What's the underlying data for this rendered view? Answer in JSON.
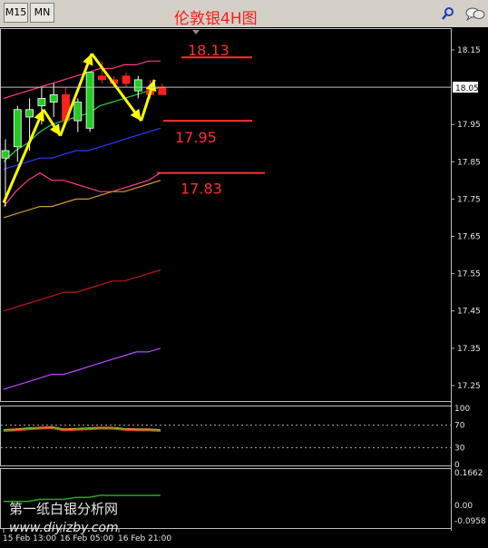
{
  "toolbar": {
    "tabs": [
      {
        "label": "M15"
      },
      {
        "label": "MN"
      }
    ],
    "title": "伦敦银4H图",
    "search_icon": "search-icon",
    "chat_icon": "chat-icon"
  },
  "chart_data": {
    "type": "candlestick",
    "title": "伦敦银4H图",
    "price_axis": {
      "ticks": [
        18.15,
        17.95,
        17.85,
        17.75,
        17.65,
        17.55,
        17.45,
        17.35,
        17.25
      ],
      "current_price_label": "18.05",
      "current_price": 18.05
    },
    "time_axis": {
      "labels": [
        "15 Feb 13:00",
        "16 Feb 05:00",
        "16 Feb 21:00"
      ]
    },
    "candles": [
      {
        "o": 17.86,
        "h": 17.91,
        "l": 17.73,
        "c": 17.88
      },
      {
        "o": 17.89,
        "h": 18.0,
        "l": 17.85,
        "c": 17.99
      },
      {
        "o": 17.97,
        "h": 18.02,
        "l": 17.88,
        "c": 17.99
      },
      {
        "o": 18.0,
        "h": 18.05,
        "l": 17.95,
        "c": 18.02
      },
      {
        "o": 18.01,
        "h": 18.06,
        "l": 17.97,
        "c": 18.03
      },
      {
        "o": 18.03,
        "h": 18.05,
        "l": 17.95,
        "c": 17.96
      },
      {
        "o": 17.96,
        "h": 18.02,
        "l": 17.93,
        "c": 18.01
      },
      {
        "o": 17.94,
        "h": 18.09,
        "l": 17.93,
        "c": 18.09
      },
      {
        "o": 18.08,
        "h": 18.12,
        "l": 18.06,
        "c": 18.07
      },
      {
        "o": 18.07,
        "h": 18.08,
        "l": 18.05,
        "c": 18.06
      },
      {
        "o": 18.08,
        "h": 18.09,
        "l": 18.05,
        "c": 18.06
      },
      {
        "o": 18.04,
        "h": 18.08,
        "l": 18.02,
        "c": 18.07
      },
      {
        "o": 18.05,
        "h": 18.07,
        "l": 18.02,
        "c": 18.03
      },
      {
        "o": 18.05,
        "h": 18.06,
        "l": 18.03,
        "c": 18.03
      }
    ],
    "levels": [
      {
        "label": "18.13",
        "value": 18.13,
        "color": "#ff3030"
      },
      {
        "label": "17.95",
        "value": 17.96,
        "color": "#ff3030"
      },
      {
        "label": "17.83",
        "value": 17.82,
        "color": "#ff3030"
      }
    ],
    "indicators": [
      {
        "name": "upper",
        "color": "#ff3b8a",
        "values": [
          18.02,
          18.03,
          18.04,
          18.05,
          18.06,
          18.07,
          18.08,
          18.09,
          18.1,
          18.1,
          18.11,
          18.11,
          18.12,
          18.12
        ]
      },
      {
        "name": "ma-green",
        "color": "#33cc33",
        "values": [
          17.85,
          17.88,
          17.9,
          17.93,
          17.95,
          17.96,
          17.97,
          17.98,
          18.0,
          18.01,
          18.02,
          18.03,
          18.04,
          18.05
        ]
      },
      {
        "name": "mid-blue",
        "color": "#2a3cff",
        "values": [
          17.83,
          17.84,
          17.85,
          17.86,
          17.86,
          17.87,
          17.88,
          17.88,
          17.89,
          17.9,
          17.91,
          17.92,
          17.93,
          17.94
        ]
      },
      {
        "name": "lower",
        "color": "#ff3b8a",
        "values": [
          17.73,
          17.77,
          17.8,
          17.82,
          17.8,
          17.8,
          17.79,
          17.78,
          17.77,
          17.77,
          17.78,
          17.79,
          17.8,
          17.82
        ]
      },
      {
        "name": "ma-orange",
        "color": "#d69a2a",
        "values": [
          17.7,
          17.71,
          17.72,
          17.73,
          17.73,
          17.74,
          17.75,
          17.75,
          17.76,
          17.77,
          17.77,
          17.78,
          17.79,
          17.8
        ]
      },
      {
        "name": "ma-red",
        "color": "#c01818",
        "values": [
          17.45,
          17.46,
          17.47,
          17.48,
          17.49,
          17.5,
          17.5,
          17.51,
          17.52,
          17.53,
          17.53,
          17.54,
          17.55,
          17.56
        ]
      },
      {
        "name": "ma-violet",
        "color": "#b44cff",
        "values": [
          17.24,
          17.25,
          17.26,
          17.27,
          17.28,
          17.28,
          17.29,
          17.3,
          17.31,
          17.32,
          17.33,
          17.34,
          17.34,
          17.35
        ]
      }
    ],
    "arrows": [
      {
        "from": [
          0,
          17.74
        ],
        "to": [
          3.3,
          17.99
        ]
      },
      {
        "from": [
          3.3,
          17.99
        ],
        "to": [
          4.7,
          17.92
        ]
      },
      {
        "from": [
          4.7,
          17.92
        ],
        "to": [
          7.3,
          18.14
        ]
      },
      {
        "from": [
          7.3,
          18.14
        ],
        "to": [
          11.4,
          17.96
        ]
      },
      {
        "from": [
          11.4,
          17.96
        ],
        "to": [
          12.5,
          18.07
        ]
      }
    ],
    "rsi": {
      "ticks": [
        "100",
        "70",
        "30",
        "0"
      ],
      "levels": [
        70,
        30
      ],
      "values": [
        62,
        63,
        65,
        66,
        67,
        63,
        64,
        65,
        66,
        66,
        64,
        63,
        63,
        62
      ],
      "color": "#ff3030"
    },
    "macd": {
      "ticks": [
        "0.1662",
        "0.00",
        "-0.0958"
      ],
      "values": [
        0.02,
        0.02,
        0.02,
        0.03,
        0.03,
        0.03,
        0.04,
        0.04,
        0.05,
        0.05,
        0.05,
        0.05,
        0.05,
        0.05
      ],
      "color": "#22aa22"
    }
  },
  "watermark": {
    "line1": "第一纸白银分析网",
    "line2": "www.diyizby.com"
  }
}
